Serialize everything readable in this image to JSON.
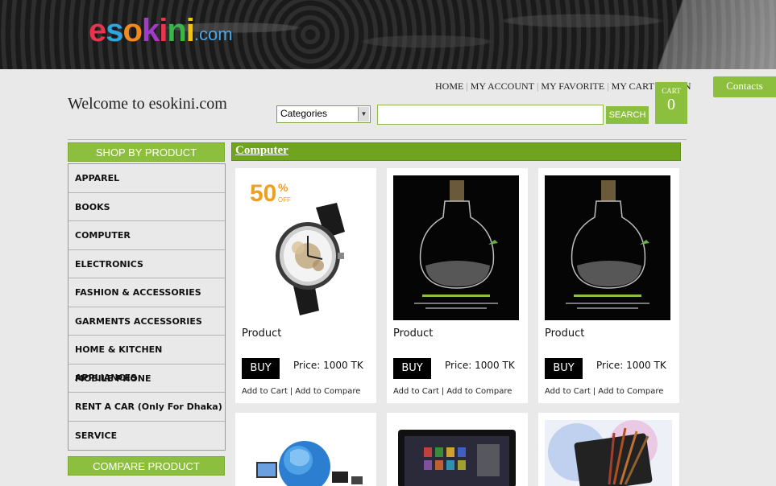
{
  "header": {
    "logo_main": "esokini",
    "logo_suffix": ".com",
    "logo_colors": [
      "#e8354d",
      "#2fa6e0",
      "#f08a1c",
      "#a23cc8",
      "#e8354d",
      "#3ab54a",
      "#f0c419"
    ]
  },
  "welcome": "Welcome to esokini.com",
  "topnav": [
    "HOME",
    "MY ACCOUNT",
    "MY FAVORITE",
    "MY CART",
    "LOGIN"
  ],
  "search": {
    "category_value": "Categories",
    "query": "",
    "button_label": "SEARCH"
  },
  "cart": {
    "label": "CART",
    "count": "0"
  },
  "contacts_label": "Contacts",
  "sidebar": {
    "shop_title": "SHOP BY PRODUCT",
    "items": [
      "APPAREL",
      "BOOKS",
      "COMPUTER",
      "ELECTRONICS",
      "FASHION & ACCESSORIES",
      "GARMENTS ACCESSORIES",
      "HOME & KITCHEN APPLIANCES",
      "MOBILE PHONE",
      "RENT A CAR (Only For Dhaka)",
      "SERVICE"
    ],
    "compare_title": "COMPARE PRODUCT"
  },
  "category_title": "Computer",
  "products": [
    {
      "name": "Product",
      "buy": "BUY",
      "price": "Price: 1000 TK",
      "add_cart": "Add to Cart",
      "add_compare": "Add to Compare",
      "image": "watch",
      "badge": "50",
      "badge_pct": "%",
      "badge_off": "OFF"
    },
    {
      "name": "Product",
      "buy": "BUY",
      "price": "Price: 1000 TK",
      "add_cart": "Add to Cart",
      "add_compare": "Add to Compare",
      "image": "bulb"
    },
    {
      "name": "Product",
      "buy": "BUY",
      "price": "Price: 1000 TK",
      "add_cart": "Add to Cart",
      "add_compare": "Add to Compare",
      "image": "bulb"
    },
    {
      "image": "globe-devices"
    },
    {
      "image": "tablet-apps"
    },
    {
      "image": "tablet-brushes"
    }
  ],
  "colors": {
    "accent_green": "#8dbf3f",
    "category_green": "#6fa41f"
  }
}
